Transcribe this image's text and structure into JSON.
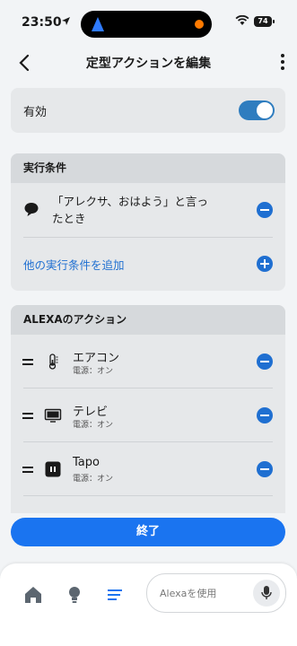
{
  "status": {
    "time": "23:50",
    "battery": "74"
  },
  "header": {
    "title": "定型アクションを編集"
  },
  "enabled": {
    "label": "有効",
    "on": true
  },
  "trigger": {
    "section_title": "実行条件",
    "phrase_line1": "「アレクサ、おはよう」と言っ",
    "phrase_line2": "たとき",
    "add_label": "他の実行条件を追加"
  },
  "actions": {
    "section_title": "ALEXAのアクション",
    "items": [
      {
        "name": "エアコン",
        "sub": "電源：オン",
        "icon": "thermometer-icon"
      },
      {
        "name": "テレビ",
        "sub": "電源：オン",
        "icon": "tv-icon"
      },
      {
        "name": "Tapo",
        "sub": "電源：オン",
        "icon": "smart-plug-icon"
      }
    ]
  },
  "finish_label": "終了",
  "tabbar": {
    "placeholder": "Alexaを使用"
  },
  "colors": {
    "accent": "#1a74f0",
    "toggle": "#2f7dbf",
    "link": "#1f6fd1"
  }
}
